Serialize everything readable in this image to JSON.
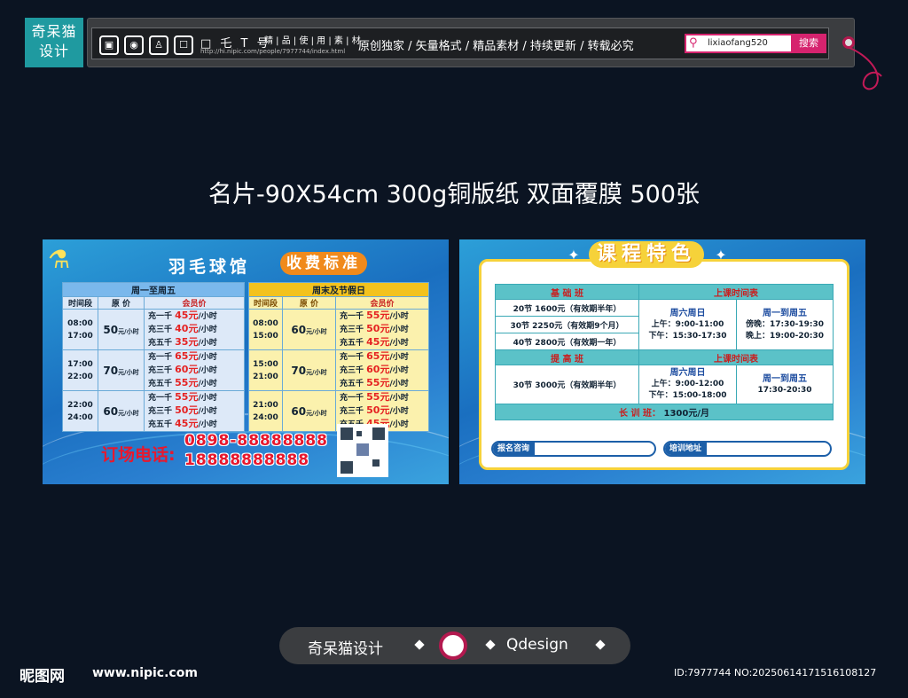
{
  "topbar": {
    "logo_line1": "奇呆猫",
    "logo_line2": "设计",
    "icons": [
      "gift-icon",
      "camera-icon",
      "dress-icon",
      "bag-icon"
    ],
    "glyphs": "□ 乇 T 号",
    "title_small": "精 | 品 | 使 | 用 | 素 | 材",
    "url_small": "http://hi.nipic.com/people/7977744/index.html",
    "slogan": "原创独家 / 矢量格式 / 精品素材 / 持续更新 / 转载必究",
    "search_value": "lixiaofang520",
    "search_button": "搜索"
  },
  "headline": "名片-90X54cm 300g铜版纸 双面覆膜 500张",
  "left_card": {
    "title_a": "羽毛球馆",
    "title_b": "收费标准",
    "weekday": {
      "header": "周一至周五",
      "cols": [
        "时间段",
        "原 价",
        "会员价"
      ],
      "rows": [
        {
          "time1": "08:00",
          "time2": "17:00",
          "price": "50",
          "unit": "元/小时",
          "member": [
            [
              "充一千",
              "45元",
              "/小时"
            ],
            [
              "充三千",
              "40元",
              "/小时"
            ],
            [
              "充五千",
              "35元",
              "/小时"
            ]
          ]
        },
        {
          "time1": "17:00",
          "time2": "22:00",
          "price": "70",
          "unit": "元/小时",
          "member": [
            [
              "充一千",
              "65元",
              "/小时"
            ],
            [
              "充三千",
              "60元",
              "/小时"
            ],
            [
              "充五千",
              "55元",
              "/小时"
            ]
          ]
        },
        {
          "time1": "22:00",
          "time2": "24:00",
          "price": "60",
          "unit": "元/小时",
          "member": [
            [
              "充一千",
              "55元",
              "/小时"
            ],
            [
              "充三千",
              "50元",
              "/小时"
            ],
            [
              "充五千",
              "45元",
              "/小时"
            ]
          ]
        }
      ]
    },
    "weekend": {
      "header": "周末及节假日",
      "cols": [
        "时间段",
        "原 价",
        "会员价"
      ],
      "rows": [
        {
          "time1": "08:00",
          "time2": "15:00",
          "price": "60",
          "unit": "元/小时",
          "member": [
            [
              "充一千",
              "55元",
              "/小时"
            ],
            [
              "充三千",
              "50元",
              "/小时"
            ],
            [
              "充五千",
              "45元",
              "/小时"
            ]
          ]
        },
        {
          "time1": "15:00",
          "time2": "21:00",
          "price": "70",
          "unit": "元/小时",
          "member": [
            [
              "充一千",
              "65元",
              "/小时"
            ],
            [
              "充三千",
              "60元",
              "/小时"
            ],
            [
              "充五千",
              "55元",
              "/小时"
            ]
          ]
        },
        {
          "time1": "21:00",
          "time2": "24:00",
          "price": "60",
          "unit": "元/小时",
          "member": [
            [
              "充一千",
              "55元",
              "/小时"
            ],
            [
              "充三千",
              "50元",
              "/小时"
            ],
            [
              "充五千",
              "45元",
              "/小时"
            ]
          ]
        }
      ]
    },
    "phone_label": "订场电话:",
    "phone1": "0898-88888888",
    "phone2": "18888888888"
  },
  "right_card": {
    "title": "课程特色",
    "basic": {
      "header": "基 础 班",
      "items": [
        "20节 1600元（有效期半年）",
        "30节 2250元（有效期9个月）",
        "40节 2800元（有效期一年）"
      ]
    },
    "schedule1": {
      "header": "上课时间表",
      "col1_head": "周六周日",
      "col1_lines": [
        "上午：9:00-11:00",
        "下午：15:30-17:30"
      ],
      "col2_head": "周一到周五",
      "col2_lines": [
        "傍晚：17:30-19:30",
        "晚上：19:00-20:30"
      ]
    },
    "advanced": {
      "header": "提 高 班",
      "items": [
        "30节 3000元（有效期半年）"
      ]
    },
    "schedule2": {
      "header": "上课时间表",
      "col1_head": "周六周日",
      "col1_lines": [
        "上午：9:00-12:00",
        "下午：15:00-18:00"
      ],
      "col2_head": "周一到周五",
      "col2_lines": [
        "17:30-20:30"
      ]
    },
    "long_label": "长 训 班：",
    "long_value": "1300元/月",
    "consult_label": "报名咨询",
    "address_label": "培训地址"
  },
  "bottom": {
    "brand": "奇呆猫设计",
    "q": "Qdesign",
    "wm_site": "昵图网",
    "wm_url": "www.nipic.com",
    "wm_id": "ID:7977744 NO:20250614171516108127"
  }
}
